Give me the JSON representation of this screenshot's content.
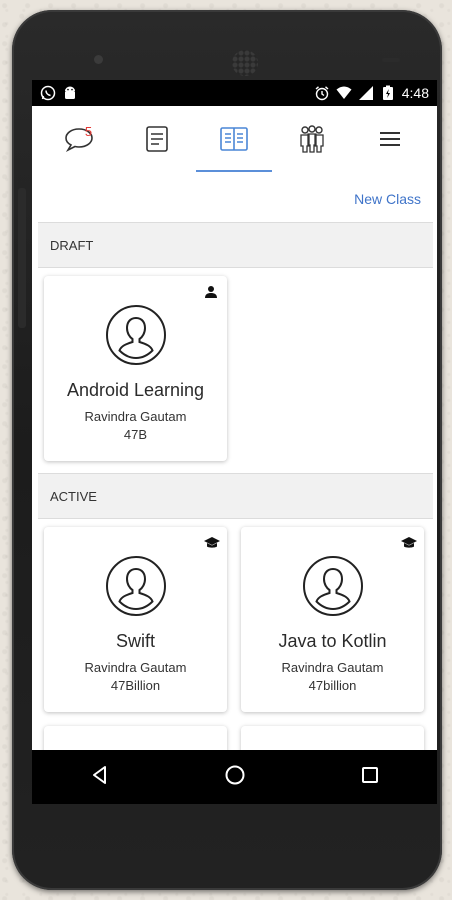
{
  "status_bar": {
    "time": "4:48",
    "left_icons": [
      "whatsapp-icon",
      "android-icon"
    ],
    "right_icons": [
      "alarm-icon",
      "wifi-icon",
      "signal-icon",
      "battery-charging-icon"
    ]
  },
  "tabs": [
    {
      "icon": "chat-bubble-icon",
      "badge": "5",
      "active": false
    },
    {
      "icon": "notes-icon",
      "active": false
    },
    {
      "icon": "classes-book-icon",
      "active": true
    },
    {
      "icon": "people-group-icon",
      "active": false
    },
    {
      "icon": "menu-icon",
      "active": false
    }
  ],
  "actions": {
    "new_class_label": "New Class"
  },
  "sections": {
    "draft": {
      "header": "DRAFT",
      "cards": [
        {
          "title": "Android Learning",
          "owner": "Ravindra Gautam",
          "size": "47B",
          "corner_icon": "person-icon"
        }
      ]
    },
    "active": {
      "header": "ACTIVE",
      "cards": [
        {
          "title": "Swift",
          "owner": "Ravindra Gautam",
          "size": "47Billion",
          "corner_icon": "graduation-cap-icon"
        },
        {
          "title": "Java to Kotlin",
          "owner": "Ravindra Gautam",
          "size": "47billion",
          "corner_icon": "graduation-cap-icon"
        }
      ]
    }
  },
  "colors": {
    "accent": "#3f74c9",
    "tab_underline": "#5b8fd9",
    "badge": "#e53935",
    "section_bg": "#f1f1f1"
  }
}
